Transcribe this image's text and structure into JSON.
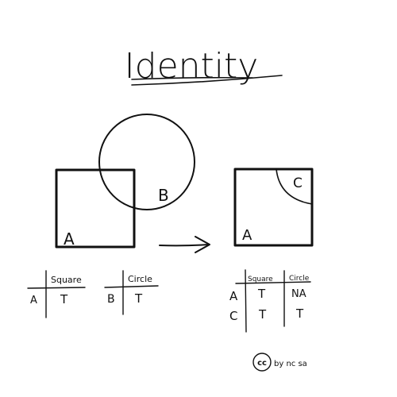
{
  "title": "Identity",
  "left_figure": {
    "square_label": "A",
    "circle_label": "B"
  },
  "right_figure": {
    "square_label": "A",
    "intersection_label": "C"
  },
  "table_a": {
    "header": "Square",
    "rows": [
      {
        "label": "A",
        "value": "T"
      }
    ]
  },
  "table_b": {
    "header": "Circle",
    "rows": [
      {
        "label": "B",
        "value": "T"
      }
    ]
  },
  "table_result": {
    "headers": [
      "Square",
      "Circle"
    ],
    "rows": [
      {
        "label": "A",
        "square": "T",
        "circle": "NA"
      },
      {
        "label": "C",
        "square": "T",
        "circle": "T"
      }
    ]
  },
  "license": {
    "cc": "cc",
    "text": "by nc sa"
  }
}
